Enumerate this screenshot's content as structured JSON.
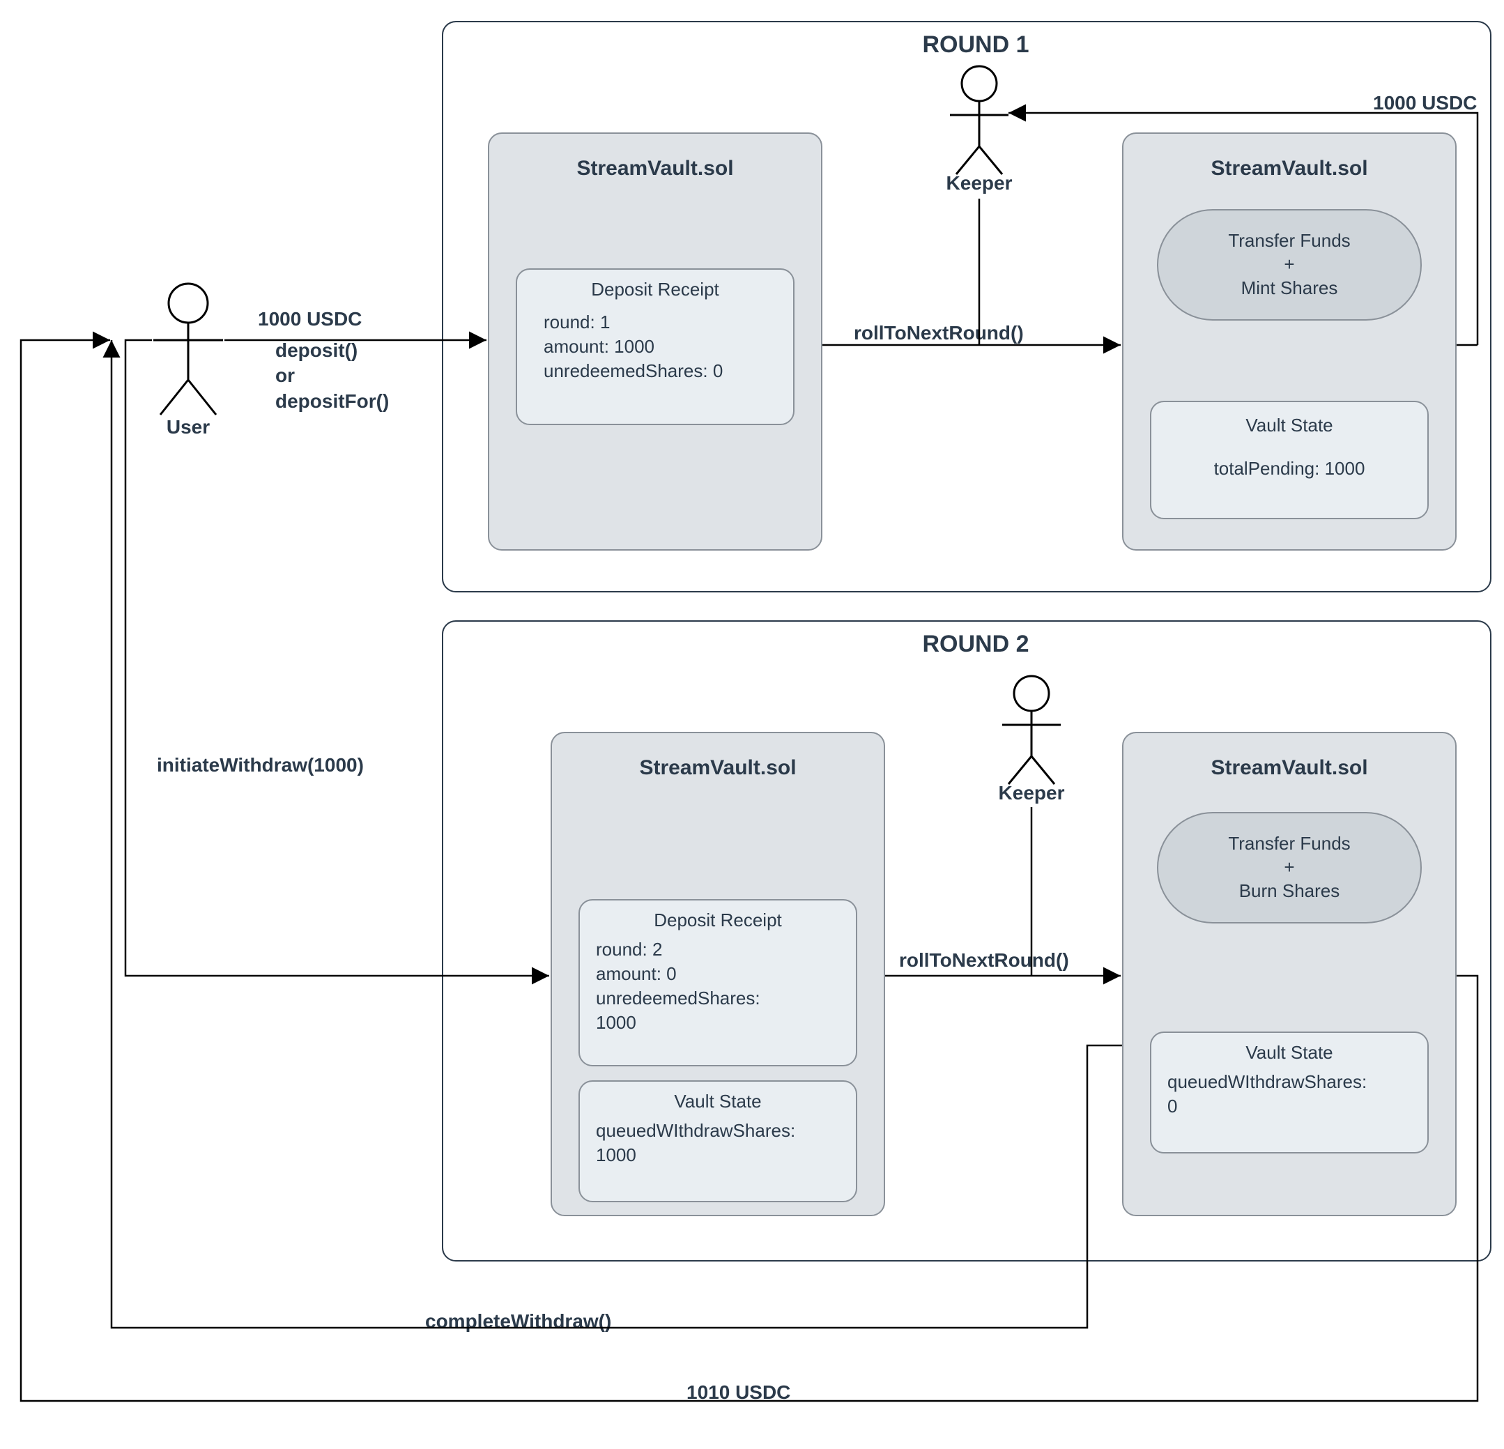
{
  "rounds": {
    "round1": {
      "title": "ROUND 1"
    },
    "round2": {
      "title": "ROUND 2"
    }
  },
  "actors": {
    "user": "User",
    "keeper1": "Keeper",
    "keeper2": "Keeper"
  },
  "callsLabels": {
    "depositAmount": "1000 USDC",
    "depositFns": "deposit()\nor\ndepositFor()",
    "roll1": "rollToNextRound()",
    "roll2": "rollToNextRound()",
    "initiateWithdraw": "initiateWithdraw(1000)",
    "completeWithdraw": "completeWithdraw()",
    "outUSDC": "1000 USDC",
    "returnUSDC": "1010 USDC"
  },
  "r1": {
    "left": {
      "cardTitle": "StreamVault.sol",
      "receiptTitle": "Deposit Receipt",
      "receiptBody": "round: 1\namount: 1000\nunredeemedShares: 0"
    },
    "right": {
      "cardTitle": "StreamVault.sol",
      "pill": "Transfer Funds\n+\nMint Shares",
      "stateTitle": "Vault State",
      "stateBody": "totalPending: 1000"
    }
  },
  "r2": {
    "left": {
      "cardTitle": "StreamVault.sol",
      "receiptTitle": "Deposit Receipt",
      "receiptBody": "round: 2\namount: 0\nunredeemedShares:\n1000",
      "stateTitle": "Vault State",
      "stateBody": "queuedWIthdrawShares:\n1000"
    },
    "right": {
      "cardTitle": "StreamVault.sol",
      "pill": "Transfer Funds\n+\nBurn Shares",
      "stateTitle": "Vault State",
      "stateBody": "queuedWIthdrawShares:\n0"
    }
  }
}
